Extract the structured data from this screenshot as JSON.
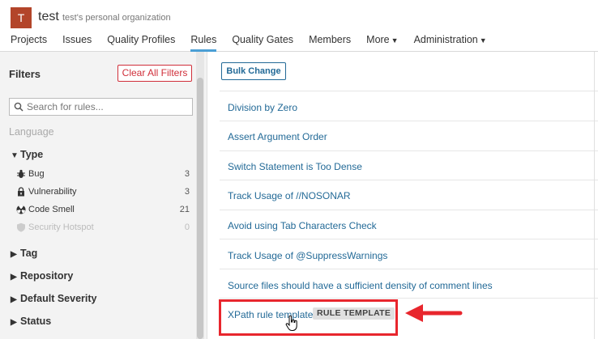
{
  "org": {
    "avatar_letter": "T",
    "name": "test",
    "description": "test's personal organization"
  },
  "nav": [
    {
      "label": "Projects"
    },
    {
      "label": "Issues"
    },
    {
      "label": "Quality Profiles"
    },
    {
      "label": "Rules",
      "active": true
    },
    {
      "label": "Quality Gates"
    },
    {
      "label": "Members"
    },
    {
      "label": "More",
      "dropdown": true
    },
    {
      "label": "Administration",
      "dropdown": true
    }
  ],
  "filters": {
    "title": "Filters",
    "clear_label": "Clear All Filters",
    "search_placeholder": "Search for rules...",
    "language_label": "Language",
    "type": {
      "label": "Type",
      "items": [
        {
          "label": "Bug",
          "count": "3",
          "icon": "bug-icon"
        },
        {
          "label": "Vulnerability",
          "count": "3",
          "icon": "lock-icon"
        },
        {
          "label": "Code Smell",
          "count": "21",
          "icon": "radiation-icon"
        },
        {
          "label": "Security Hotspot",
          "count": "0",
          "icon": "shield-icon",
          "disabled": true
        }
      ]
    },
    "collapsed_facets": [
      "Tag",
      "Repository",
      "Default Severity",
      "Status"
    ]
  },
  "main": {
    "bulk_change_label": "Bulk Change",
    "rules": [
      "Division by Zero",
      "Assert Argument Order",
      "Switch Statement is Too Dense",
      "Track Usage of //NOSONAR",
      "Avoid using Tab Characters Check",
      "Track Usage of @SuppressWarnings",
      "Source files should have a sufficient density of comment lines",
      "XPath rule template"
    ],
    "template_badge": "RULE TEMPLATE"
  },
  "colors": {
    "accent": "#4b9fd5",
    "link": "#236a97",
    "danger": "#d02f3a",
    "avatar": "#b3452a",
    "highlight": "#e8262d"
  }
}
